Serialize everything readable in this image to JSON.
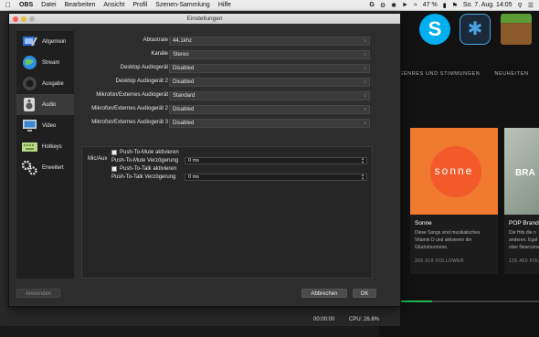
{
  "menubar": {
    "app": "OBS",
    "items": [
      "Datei",
      "Bearbeiten",
      "Ansicht",
      "Profil",
      "Szenen-Sammlung",
      "Hilfe"
    ],
    "battery": "47 %",
    "datetime": "So. 7. Aug.  14:05"
  },
  "dialog": {
    "title": "Einstellungen",
    "sidebar": [
      {
        "label": "Allgemein",
        "icon": "wrench-icon"
      },
      {
        "label": "Stream",
        "icon": "globe-icon"
      },
      {
        "label": "Ausgabe",
        "icon": "output-icon"
      },
      {
        "label": "Audio",
        "icon": "speaker-icon"
      },
      {
        "label": "Video",
        "icon": "monitor-icon"
      },
      {
        "label": "Hotkeys",
        "icon": "keyboard-icon"
      },
      {
        "label": "Erweitert",
        "icon": "gears-icon"
      }
    ],
    "active_item": "Audio",
    "rows": [
      {
        "label": "Abtastrate",
        "value": "44.1khz"
      },
      {
        "label": "Kanäle",
        "value": "Stereo"
      },
      {
        "label": "Desktop Audiogerät",
        "value": "Disabled"
      },
      {
        "label": "Desktop Audiogerät 2",
        "value": "Disabled"
      },
      {
        "label": "Mikrofon/Externes Audiogerät",
        "value": "Standard"
      },
      {
        "label": "Mikrofon/Externes Audiogerät 2",
        "value": "Disabled"
      },
      {
        "label": "Mikrofon/Externes Audiogerät 3",
        "value": "Disabled"
      }
    ],
    "mic": {
      "group_label": "Mic/Aux",
      "push_to_mute_label": "Push-To-Mute aktivieren",
      "push_to_mute_delay_label": "Push-To-Mute Verzögerung",
      "push_to_mute_delay": "0 ms",
      "push_to_talk_label": "Push-To-Talk aktivieren",
      "push_to_talk_delay_label": "Push-To-Talk Verzögerung",
      "push_to_talk_delay": "0 ms"
    },
    "buttons": {
      "apply": "Anwenden",
      "cancel": "Abbrechen",
      "ok": "OK"
    }
  },
  "statusbar": {
    "time": "00:00:00",
    "cpu": "CPU: 26.8%"
  },
  "spotify": {
    "nav": [
      "GENRES UND STIMMUNGEN",
      "NEUHEITEN"
    ],
    "tiles": [
      {
        "art_text": "sonne",
        "name": "Sonne",
        "desc1": "Diese Songs sind musikalisches",
        "desc2": "Vitamin D und aktivieren die",
        "desc3": "Glückshormone.",
        "followers": "206.919 FOLLOWER"
      },
      {
        "art_text": "BRA",
        "name": "POP Brandr",
        "desc1": "Die Hits die n",
        "desc2": "anderen. Egal",
        "desc3": "oder Newcome",
        "followers": "125.450 FOLLO"
      }
    ]
  },
  "colors": {
    "accent_green": "#1db954",
    "sonne_orange": "#f07a30",
    "dialog_bg": "#2d2d2d"
  }
}
